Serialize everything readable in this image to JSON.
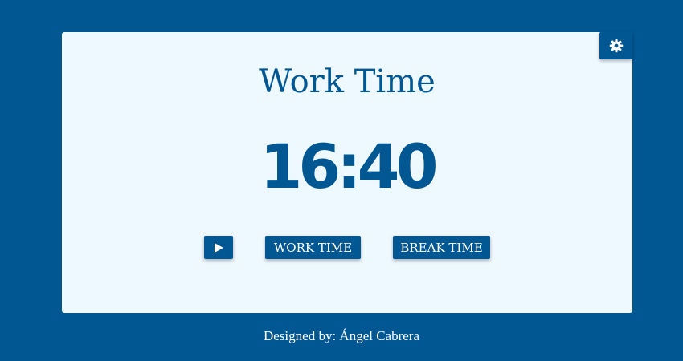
{
  "timer": {
    "title": "Work Time",
    "time": "16:40"
  },
  "controls": {
    "play_icon": "play-icon",
    "work_label": "WORK TIME",
    "break_label": "BREAK TIME"
  },
  "settings": {
    "icon": "gear-icon"
  },
  "footer": {
    "credit": "Designed by: Ángel Cabrera"
  },
  "colors": {
    "primary": "#005792",
    "card_background": "#eef9ff",
    "button_text": "#ffffff"
  }
}
